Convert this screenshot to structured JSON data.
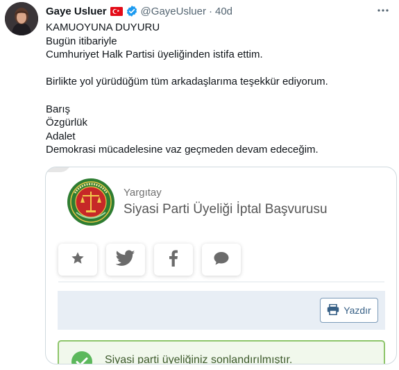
{
  "tweet": {
    "author": {
      "display_name": "Gaye Usluer",
      "handle": "@GayeUsluer",
      "flag_icon": "turkey-flag-icon",
      "verified_icon": "verified-badge-icon",
      "verified_color": "#1d9bf0"
    },
    "separator": "·",
    "timestamp": "40d",
    "more_icon": "more-horizontal-icon",
    "text_lines": [
      "KAMUOYUNA DUYURU",
      "Bugün itibariyle",
      "Cumhuriyet Halk Partisi üyeliğinden istifa ettim.",
      "",
      "Birlikte yol yürüdüğüm tüm arkadaşlarıma teşekkür ediyorum.",
      "",
      "Barış",
      "Özgürlük",
      "Adalet",
      "Demokrasi mücadelesine vaz geçmeden devam edeceğim."
    ]
  },
  "embedded_image": {
    "logo_icon": "yargitay-seal-icon",
    "site_name": "Yargıtay",
    "page_title": "Siyasi Parti Üyeliği İptal Başvurusu",
    "share_buttons": [
      {
        "icon": "star-icon"
      },
      {
        "icon": "twitter-bird-icon"
      },
      {
        "icon": "facebook-icon"
      },
      {
        "icon": "chat-bubble-icon"
      }
    ],
    "print_button": {
      "icon": "printer-icon",
      "label": "Yazdır"
    },
    "alert": {
      "icon": "check-circle-icon",
      "text": "Siyasi parti üyeliğiniz sonlandırılmıştır."
    },
    "colors": {
      "accent": "#365f85",
      "success": "#5cb85c",
      "toolbar_bg": "#e8eef5",
      "seal_green": "#2e7d32"
    }
  }
}
